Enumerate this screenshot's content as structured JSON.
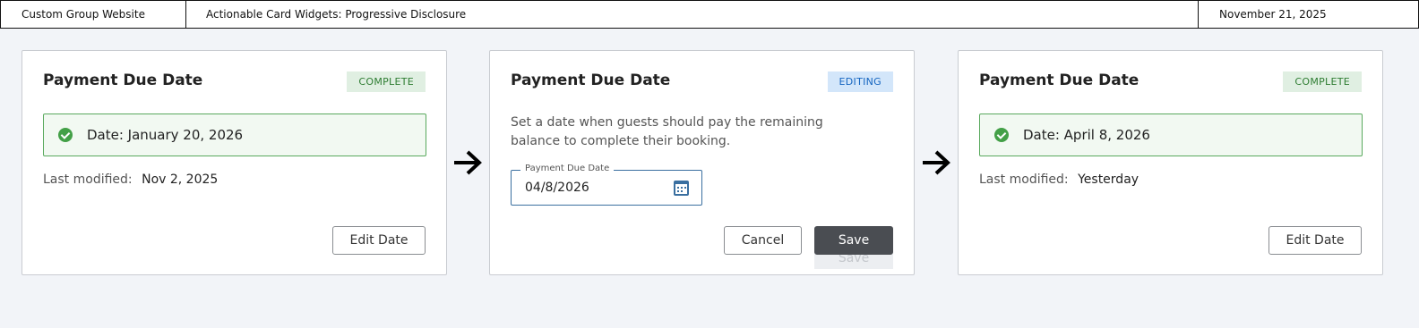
{
  "header": {
    "site": "Custom Group Website",
    "title": "Actionable Card Widgets: Progressive Disclosure",
    "date": "November 21, 2025"
  },
  "cards": [
    {
      "title": "Payment Due Date",
      "badge": "COMPLETE",
      "status": "Date: January 20, 2026",
      "modified_label": "Last modified:",
      "modified_value": "Nov 2, 2025",
      "edit_label": "Edit Date"
    },
    {
      "title": "Payment Due Date",
      "badge": "EDITING",
      "description": "Set a date when guests should pay the remaining balance to complete their booking.",
      "field_label": "Payment Due Date",
      "field_value": "04/8/2026",
      "cancel_label": "Cancel",
      "save_label": "Save",
      "save_ghost_label": "Save"
    },
    {
      "title": "Payment Due Date",
      "badge": "COMPLETE",
      "status": "Date: April 8, 2026",
      "modified_label": "Last modified:",
      "modified_value": "Yesterday",
      "edit_label": "Edit Date"
    }
  ],
  "icons": {
    "check": "check-circle-icon",
    "calendar": "calendar-icon",
    "arrow": "arrow-right-icon"
  },
  "colors": {
    "complete_bg": "#e0efe2",
    "complete_text": "#2e7d32",
    "editing_bg": "#d3e6fa",
    "editing_text": "#1565c0",
    "success_border": "#59a95d",
    "primary_button": "#4a4d52"
  }
}
